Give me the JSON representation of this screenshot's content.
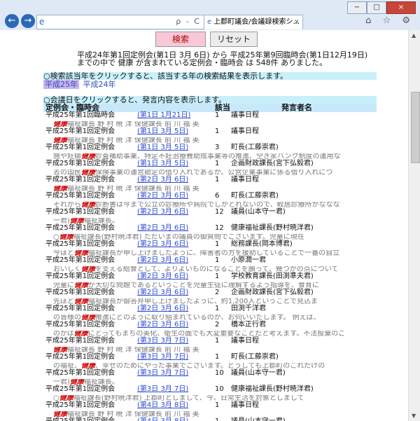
{
  "browser": {
    "back_glyph": "←",
    "forward_glyph": "→",
    "address_tools": "ρ - C",
    "tab_title": "上郡町議会/会議録検索シ...",
    "tab_close": "×",
    "right_tools": "⌂ ☆ ⚙",
    "win_min": "−",
    "win_max": "□",
    "win_close": "×"
  },
  "toolbar": {
    "search_label": "検索",
    "reset_label": "リセット"
  },
  "summary": "平成24年第1回定例会(第1日 3月 6日) から 平成25年第9回臨時会(第1日12月19日)までの中で 健康 が含まれている定例会・臨時会 は 548件 ありました。",
  "year_hint": "○検索該当年をクリックすると、該当する年の検索結果を表示します。",
  "years": [
    "平成25年",
    "平成24年"
  ],
  "minutes_hint": "○会議日をクリックすると、発言内容を表示します。",
  "columns": {
    "meeting": "定例会・臨時会",
    "item": "該当",
    "speaker": "発言者名"
  },
  "keyword": "健康",
  "rows": [
    {
      "meeting": "平成25年第1回臨時会",
      "date": "(第1日 1月21日)",
      "num": "1",
      "speaker": "議事日程",
      "pre": "",
      "post": "福祉課長 野 村 暁 洋   保健課長   前 川 福 美"
    },
    {
      "meeting": "平成25年第1回定例会",
      "date": "(第1日 3月 5日)",
      "num": "1",
      "speaker": "議事日程",
      "pre": "",
      "post": "福祉課長 野 村 暁 洋   保健課長   前 川 福 美"
    },
    {
      "meeting": "平成25年第1回定例会",
      "date": "(第1日 3月 5日)",
      "num": "3",
      "speaker": "町長(工藤崇君)",
      "pre": "施や妊婦",
      "post": "診査補助事業、特定不妊治療費助成事業等の推進、空き家バンク制度の運用な"
    },
    {
      "meeting": "平成25年第1回定例会",
      "date": "(第1日 3月 5日)",
      "num": "1",
      "speaker": "企画財政課長(宮下弘毅君)",
      "pre": "去の国民",
      "post": "保険事業の運営勘定の借り入れであるか、公営企業事業に係る借り入れにつ"
    },
    {
      "meeting": "平成25年第1回定例会",
      "date": "(第2日 3月 6日)",
      "num": "1",
      "speaker": "議事日程",
      "pre": "",
      "post": "福祉課長 野 村 暁 洋   保健課長   前 川 福 美"
    },
    {
      "meeting": "平成25年第1回定例会",
      "date": "(第2日 3月 6日)",
      "num": "6",
      "speaker": "町長(工藤崇君)",
      "pre": "それから",
      "post": "診断書は今まで公立の診療所や病院でしかとれないので、較居診療所がななな"
    },
    {
      "meeting": "平成25年第1回定例会",
      "date": "(第2日 3月 6日)",
      "num": "12",
      "speaker": "議員(山本守一君)",
      "pre": "一君)",
      "post": "福祉課長。"
    },
    {
      "meeting": "平成25年第1回定例会",
      "date": "(第2日 3月 6日)",
      "num": "12",
      "speaker": "健康福祉課長(野村暁洋君)",
      "pre": "○",
      "post": "福祉課長(野村暁洋君) ただいまの議員の御質問でございます。児童に現在"
    },
    {
      "meeting": "平成25年第1回定例会",
      "date": "(第2日 3月 6日)",
      "num": "1",
      "speaker": "総務課長(岡本博君)",
      "pre": "今ほど",
      "post": "福祉課長が申し上げましたように、障害者の方を援助していることで一番の自立"
    },
    {
      "meeting": "平成25年第1回定例会",
      "date": "(第2日 3月 6日)",
      "num": "1",
      "speaker": "小原潤一君",
      "pre": "おいしく",
      "post": "を支える給食として、よりよいものになることを願って、幾つかの点について"
    },
    {
      "meeting": "平成25年第1回定例会",
      "date": "(第2日 3月 6日)",
      "num": "1",
      "speaker": "学校教育課長(田渕準夫君)",
      "pre": "児童に",
      "post": "が大切な問題であるということを児童生徒に理解するよう指導を、食育に"
    },
    {
      "meeting": "平成25年第1回定例会",
      "date": "(第2日 3月 6日)",
      "num": "2",
      "speaker": "企画財政課長(宮下弘毅君)",
      "pre": "先ほど",
      "post": "福祉課長が御答弁申し上げましたように、約1,200人ということで見込ま"
    },
    {
      "meeting": "平成25年第1回定例会",
      "date": "(第2日 3月 6日)",
      "num": "1",
      "speaker": "田渕千洋君",
      "pre": "の皆様の",
      "post": "推進にどのように取り組まれているのか、お伺いいたします。  例えば、"
    },
    {
      "meeting": "平成25年第1回定例会",
      "date": "(第2日 3月 6日)",
      "num": "2",
      "speaker": "橋本正行君",
      "pre": "のかは",
      "post": "にとってもまちの美化、衛生の面でも大変重要なことだと考えます。不法投棄のご"
    },
    {
      "meeting": "平成25年第1回定例会",
      "date": "(第3日 3月 7日)",
      "num": "1",
      "speaker": "議事日程",
      "pre": "",
      "post": "福祉課長 野 村 暁 洋   保健課長   前 川 福 美"
    },
    {
      "meeting": "平成25年第1回定例会",
      "date": "(第3日 3月 7日)",
      "num": "1",
      "speaker": "町長(工藤崇君)",
      "pre": "の福祉、",
      "post": "、幸せのためにやった事業でございます。どうしても上郡町のこれだけの"
    },
    {
      "meeting": "平成25年第1回定例会",
      "date": "(第3日 3月 7日)",
      "num": "10",
      "speaker": "議員(山本守一君)",
      "pre": "一君)",
      "post": "福祉課長。"
    },
    {
      "meeting": "平成25年第1回定例会",
      "date": "(第3日 3月 7日)",
      "num": "10",
      "speaker": "健康福祉課長(野村暁洋君)",
      "pre": "○",
      "post": "福祉課長(野村暁洋君) 上郡町としまして、今、日常生活を対象としまして"
    },
    {
      "meeting": "平成25年第1回定例会",
      "date": "(第4日 3月 8日)",
      "num": "1",
      "speaker": "議事日程",
      "pre": "",
      "post": "福祉課長 野 村 暁 洋   保健課長   前 川 福 美"
    },
    {
      "meeting": "平成25年第1回定例会",
      "date": "(第4日 3月 8日)",
      "num": "1",
      "speaker": "議員(山本守一君)",
      "pre": "",
      "post": ""
    }
  ]
}
